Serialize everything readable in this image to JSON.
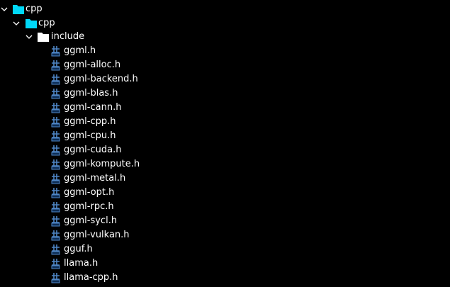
{
  "colors": {
    "background": "#000000",
    "text": "#ffffff",
    "folder_cyan": "#00d8f8",
    "folder_white": "#ffffff",
    "header_icon": "#4f86c6"
  },
  "tree": {
    "root": {
      "label": "cpp",
      "icon": "folder-icon",
      "expanded": true
    },
    "child": {
      "label": "cpp",
      "icon": "folder-icon",
      "expanded": true
    },
    "include": {
      "label": "include",
      "icon": "folder-icon",
      "expanded": true
    },
    "files": [
      {
        "label": "ggml.h"
      },
      {
        "label": "ggml-alloc.h"
      },
      {
        "label": "ggml-backend.h"
      },
      {
        "label": "ggml-blas.h"
      },
      {
        "label": "ggml-cann.h"
      },
      {
        "label": "ggml-cpp.h"
      },
      {
        "label": "ggml-cpu.h"
      },
      {
        "label": "ggml-cuda.h"
      },
      {
        "label": "ggml-kompute.h"
      },
      {
        "label": "ggml-metal.h"
      },
      {
        "label": "ggml-opt.h"
      },
      {
        "label": "ggml-rpc.h"
      },
      {
        "label": "ggml-sycl.h"
      },
      {
        "label": "ggml-vulkan.h"
      },
      {
        "label": "gguf.h"
      },
      {
        "label": "llama.h"
      },
      {
        "label": "llama-cpp.h"
      }
    ]
  }
}
